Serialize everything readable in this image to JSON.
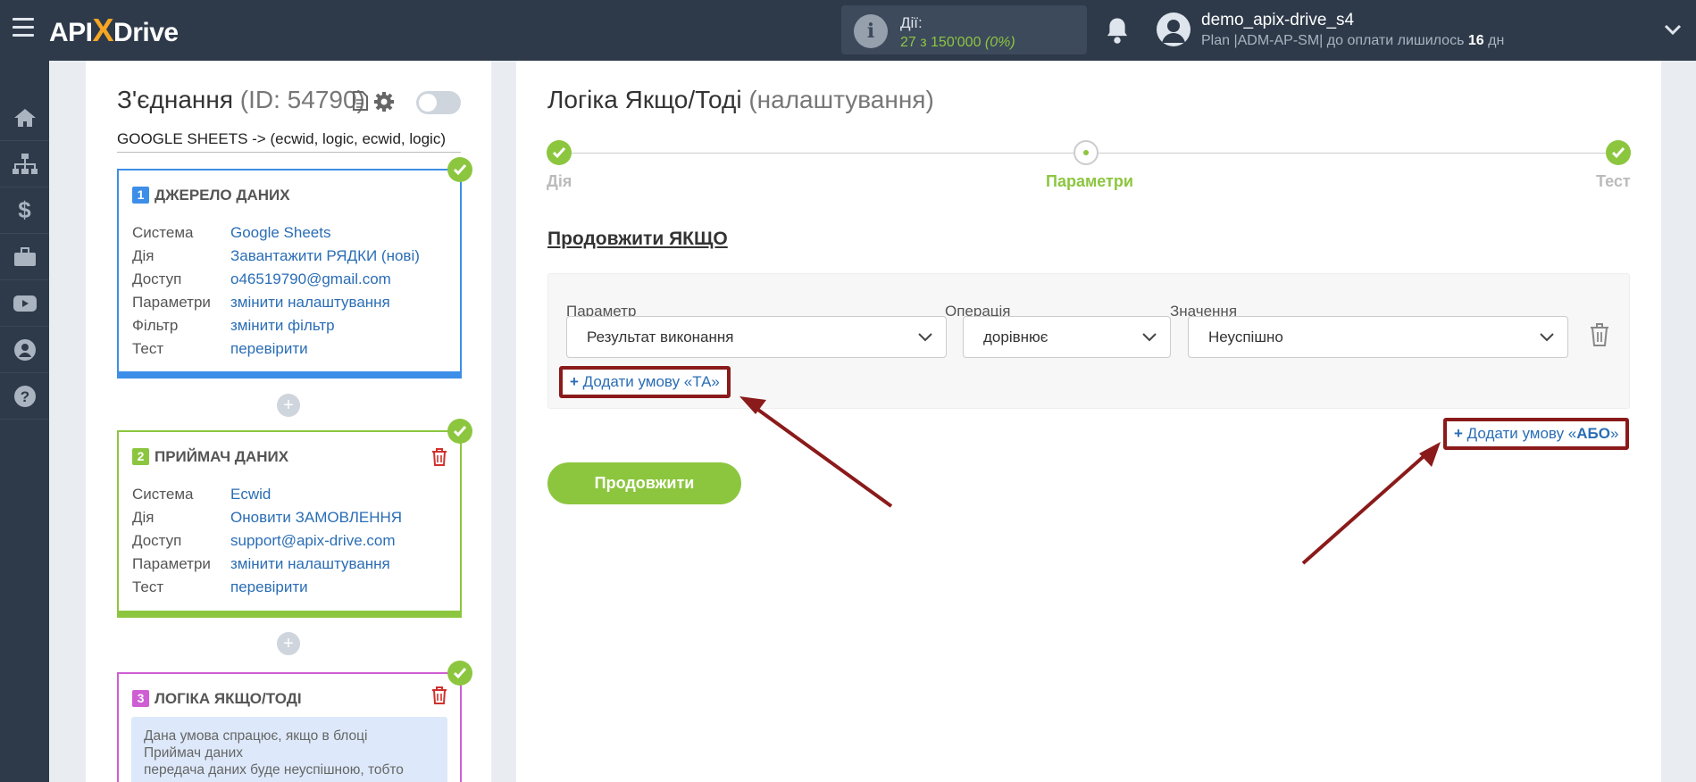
{
  "topbar": {
    "logo_pre": "API",
    "logo_x": "X",
    "logo_post": "Drive",
    "actions_label": "Дії:",
    "actions_value": "27 з 150'000",
    "actions_percent": "(0%)",
    "user_name": "demo_apix-drive_s4",
    "user_plan_pre": "Plan |ADM-AP-SM| до оплати лишилось ",
    "user_plan_days": "16",
    "user_plan_post": " дн"
  },
  "connection": {
    "title": "З'єднання",
    "id_text": "(ID: 54790)",
    "subtitle": "GOOGLE SHEETS -> (ecwid, logic, ecwid, logic)",
    "enabled": false
  },
  "blocks": [
    {
      "num": "1",
      "title": "ДЖЕРЕЛО ДАНИХ",
      "color": "#3d8ee8",
      "rows": [
        {
          "k": "Система",
          "v": "Google Sheets"
        },
        {
          "k": "Дія",
          "v": "Завантажити РЯДКИ (нові)"
        },
        {
          "k": "Доступ",
          "v": "o46519790@gmail.com"
        },
        {
          "k": "Параметри",
          "v": "змінити налаштування"
        },
        {
          "k": "Фільтр",
          "v": "змінити фільтр"
        },
        {
          "k": "Тест",
          "v": "перевірити"
        }
      ]
    },
    {
      "num": "2",
      "title": "ПРИЙМАЧ ДАНИХ",
      "color": "#8cc63f",
      "rows": [
        {
          "k": "Система",
          "v": "Ecwid"
        },
        {
          "k": "Дія",
          "v": "Оновити ЗАМОВЛЕННЯ"
        },
        {
          "k": "Доступ",
          "v": "support@apix-drive.com"
        },
        {
          "k": "Параметри",
          "v": "змінити налаштування"
        },
        {
          "k": "Тест",
          "v": "перевірити"
        }
      ]
    },
    {
      "num": "3",
      "title": "ЛОГІКА ЯКЩО/ТОДІ",
      "color": "#cf5ed4",
      "note_line1": "Дана умова спрацює, якщо в блоці",
      "note_line2": "Приймач даних",
      "note_line3": "передача даних буде неуспішною, тобто"
    }
  ],
  "main": {
    "title": "Логіка Якщо/Тоді",
    "title_sub": "(налаштування)",
    "steps": [
      {
        "label": "Дія",
        "state": "done"
      },
      {
        "label": "Параметри",
        "state": "active"
      },
      {
        "label": "Тест",
        "state": "done"
      }
    ],
    "continue_if": "Продовжити ЯКЩО",
    "labels": {
      "param": "Параметр",
      "op": "Операція",
      "value": "Значення"
    },
    "condition": {
      "param": "Результат виконання",
      "op": "дорівнює",
      "value": "Неуспішно"
    },
    "add_and": "Додати умову «ТА»",
    "add_or_pre": "Додати умову «",
    "add_or_bold": "АБО",
    "add_or_post": "»",
    "continue_button": "Продовжити"
  },
  "colors": {
    "accent_green": "#8cc63f",
    "link_blue": "#2a6db5",
    "annotation_red": "#8b1a1a",
    "topbar": "#2e3a4a"
  }
}
